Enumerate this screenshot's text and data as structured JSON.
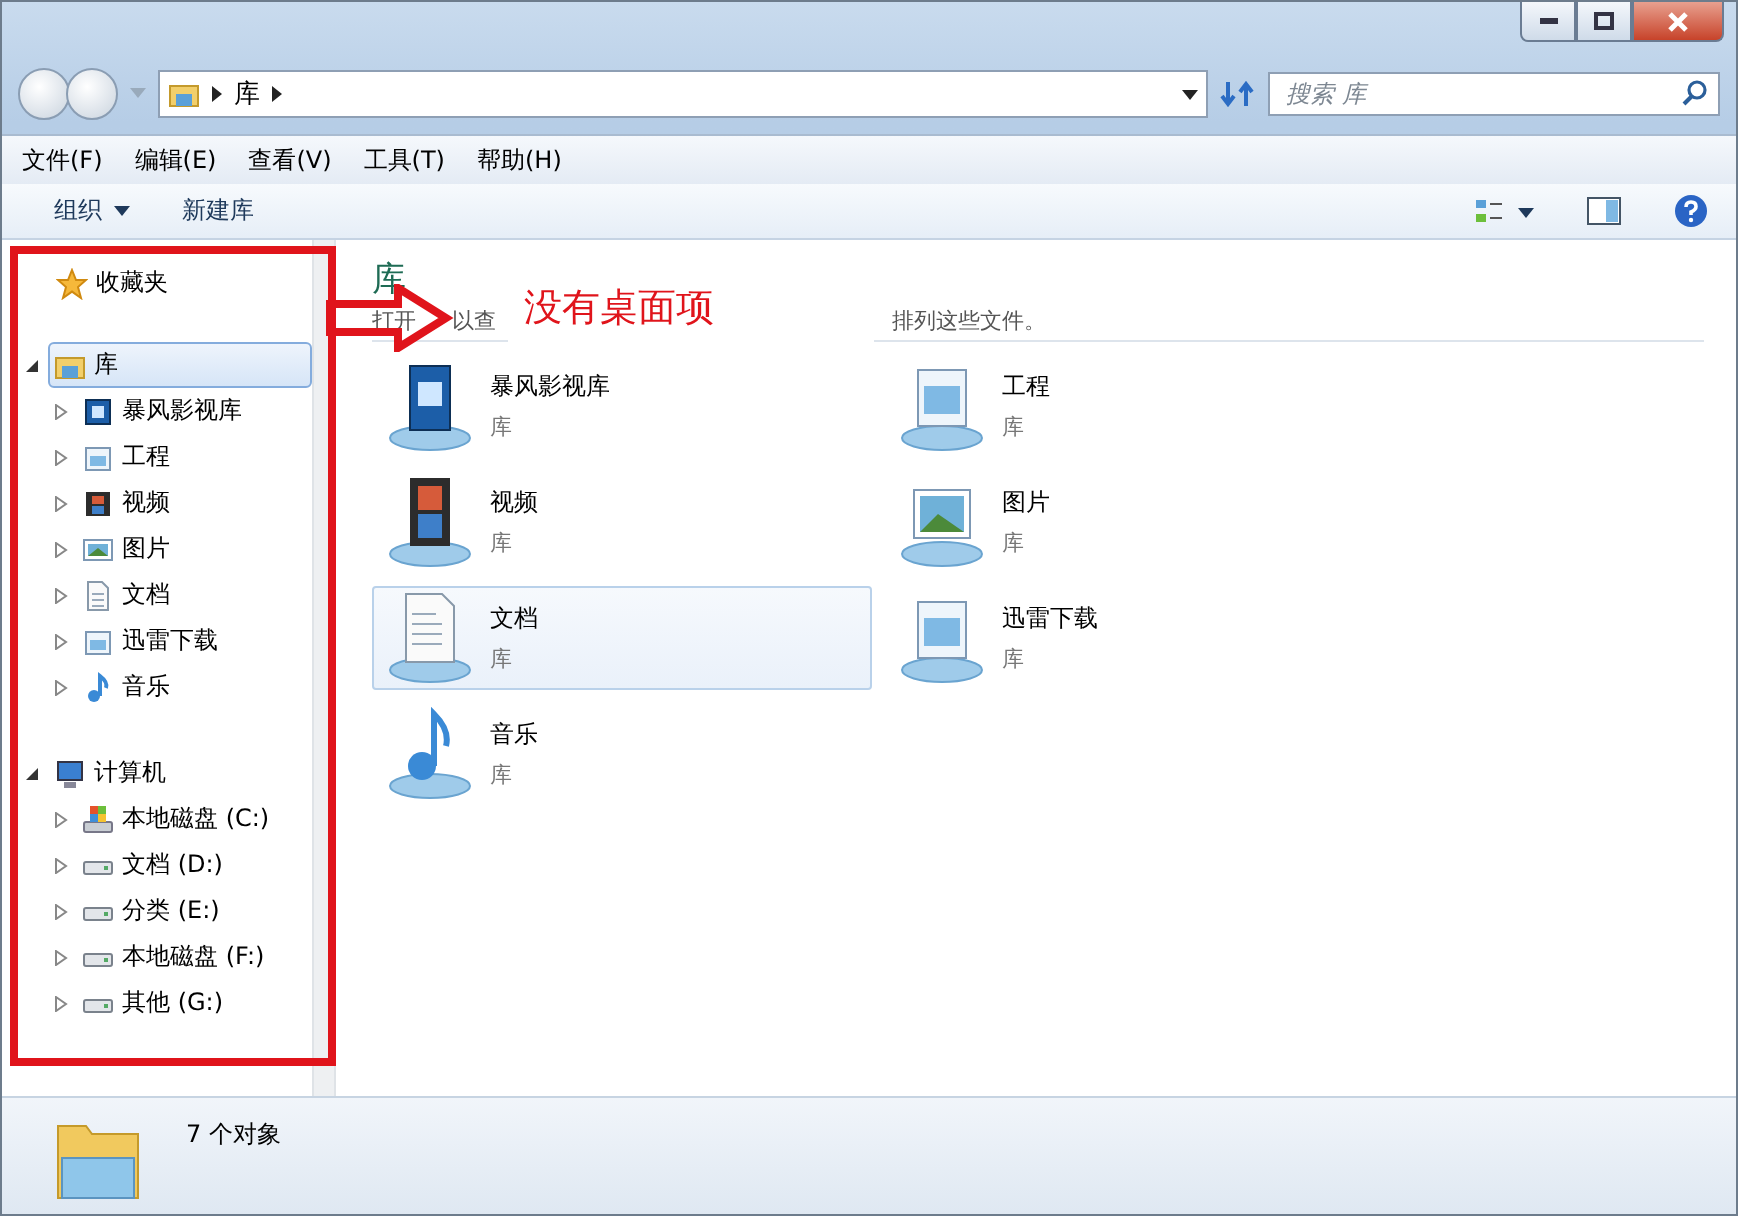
{
  "address": {
    "crumbs": [
      "库"
    ]
  },
  "search": {
    "placeholder": "搜索 库"
  },
  "menu": [
    "文件(F)",
    "编辑(E)",
    "查看(V)",
    "工具(T)",
    "帮助(H)"
  ],
  "commands": [
    {
      "label": "组织",
      "dropdown": true
    },
    {
      "label": "新建库",
      "dropdown": false
    }
  ],
  "sidebar": {
    "groups": [
      {
        "label": "收藏夹",
        "kind": "star",
        "selected": false
      },
      {
        "label": "库",
        "kind": "library",
        "expanded": true,
        "selected": true,
        "children": [
          {
            "label": "暴风影视库",
            "kind": "video"
          },
          {
            "label": "工程",
            "kind": "generic"
          },
          {
            "label": "视频",
            "kind": "film"
          },
          {
            "label": "图片",
            "kind": "picture"
          },
          {
            "label": "文档",
            "kind": "document"
          },
          {
            "label": "迅雷下载",
            "kind": "generic"
          },
          {
            "label": "音乐",
            "kind": "music"
          }
        ]
      },
      {
        "label": "计算机",
        "kind": "computer",
        "expanded": true,
        "selected": false,
        "children": [
          {
            "label": "本地磁盘 (C:)",
            "kind": "system-drive"
          },
          {
            "label": "文档 (D:)",
            "kind": "drive"
          },
          {
            "label": "分类 (E:)",
            "kind": "drive"
          },
          {
            "label": "本地磁盘 (F:)",
            "kind": "drive"
          },
          {
            "label": "其他 (G:)",
            "kind": "drive"
          }
        ]
      }
    ]
  },
  "content": {
    "heading": "库",
    "subtitle_parts": [
      "打开",
      "以查",
      "排列这些文件。"
    ],
    "items": [
      {
        "name": "暴风影视库",
        "type": "库",
        "kind": "video",
        "selected": false
      },
      {
        "name": "工程",
        "type": "库",
        "kind": "generic",
        "selected": false
      },
      {
        "name": "视频",
        "type": "库",
        "kind": "film",
        "selected": false
      },
      {
        "name": "图片",
        "type": "库",
        "kind": "picture",
        "selected": false
      },
      {
        "name": "文档",
        "type": "库",
        "kind": "document",
        "selected": true
      },
      {
        "name": "迅雷下载",
        "type": "库",
        "kind": "generic",
        "selected": false
      },
      {
        "name": "音乐",
        "type": "库",
        "kind": "music",
        "selected": false
      }
    ]
  },
  "annotation": {
    "text": "没有桌面项"
  },
  "status_bar": {
    "count": "7 个对象"
  }
}
